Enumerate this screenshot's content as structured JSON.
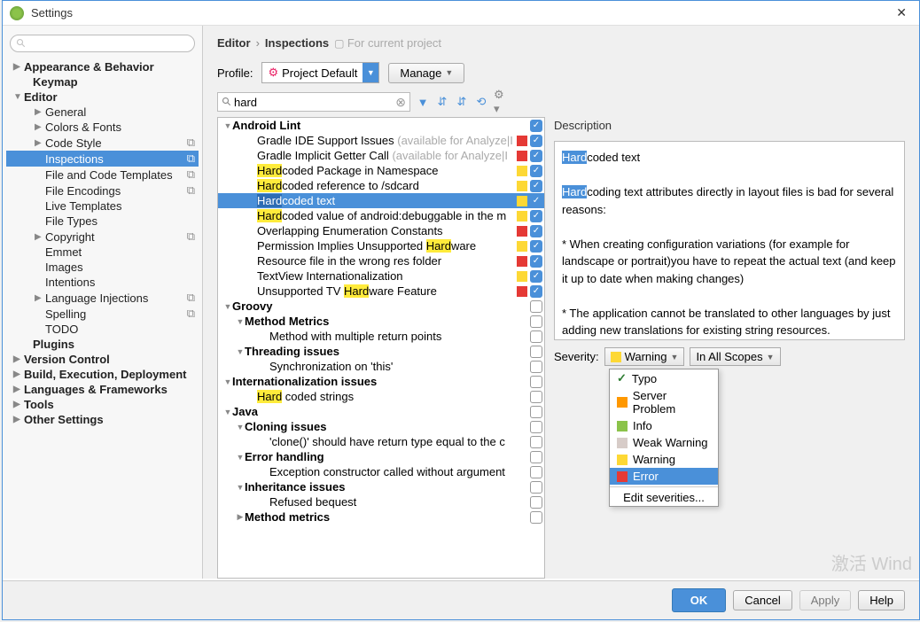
{
  "title": "Settings",
  "breadcrumb": {
    "parent": "Editor",
    "current": "Inspections",
    "scope": "For current project"
  },
  "profile": {
    "label": "Profile:",
    "value": "Project Default",
    "manage": "Manage"
  },
  "sidebar_search": "",
  "filter": {
    "value": "hard"
  },
  "sidebar": [
    {
      "label": "Appearance & Behavior",
      "lvl": 0,
      "bold": true,
      "arrow": "▶"
    },
    {
      "label": "Keymap",
      "lvl": 1,
      "bold": true
    },
    {
      "label": "Editor",
      "lvl": 0,
      "bold": true,
      "arrow": "▼"
    },
    {
      "label": "General",
      "lvl": 2,
      "arrow": "▶"
    },
    {
      "label": "Colors & Fonts",
      "lvl": 2,
      "arrow": "▶"
    },
    {
      "label": "Code Style",
      "lvl": 2,
      "arrow": "▶",
      "copy": true
    },
    {
      "label": "Inspections",
      "lvl": 2,
      "selected": true,
      "copy": true
    },
    {
      "label": "File and Code Templates",
      "lvl": 2,
      "copy": true
    },
    {
      "label": "File Encodings",
      "lvl": 2,
      "copy": true
    },
    {
      "label": "Live Templates",
      "lvl": 2
    },
    {
      "label": "File Types",
      "lvl": 2
    },
    {
      "label": "Copyright",
      "lvl": 2,
      "arrow": "▶",
      "copy": true
    },
    {
      "label": "Emmet",
      "lvl": 2
    },
    {
      "label": "Images",
      "lvl": 2
    },
    {
      "label": "Intentions",
      "lvl": 2
    },
    {
      "label": "Language Injections",
      "lvl": 2,
      "arrow": "▶",
      "copy": true
    },
    {
      "label": "Spelling",
      "lvl": 2,
      "copy": true
    },
    {
      "label": "TODO",
      "lvl": 2
    },
    {
      "label": "Plugins",
      "lvl": 1,
      "bold": true
    },
    {
      "label": "Version Control",
      "lvl": 0,
      "bold": true,
      "arrow": "▶"
    },
    {
      "label": "Build, Execution, Deployment",
      "lvl": 0,
      "bold": true,
      "arrow": "▶"
    },
    {
      "label": "Languages & Frameworks",
      "lvl": 0,
      "bold": true,
      "arrow": "▶"
    },
    {
      "label": "Tools",
      "lvl": 0,
      "bold": true,
      "arrow": "▶"
    },
    {
      "label": "Other Settings",
      "lvl": 0,
      "bold": true,
      "arrow": "▶"
    }
  ],
  "inspections": [
    {
      "indent": 0,
      "arrow": "▼",
      "bold": true,
      "label": "Android Lint",
      "chk": true
    },
    {
      "indent": 2,
      "label": "Gradle IDE Support Issues",
      "gray": " (available for Analyze|I",
      "sev": "error",
      "chk": true
    },
    {
      "indent": 2,
      "label": "Gradle Implicit Getter Call",
      "gray": " (available for Analyze|I",
      "sev": "error",
      "chk": true
    },
    {
      "indent": 2,
      "html": "<span class='hl'>Hard</span>coded Package in Namespace",
      "sev": "warning",
      "chk": true
    },
    {
      "indent": 2,
      "html": "<span class='hl'>Hard</span>coded reference to /sdcard",
      "sev": "warning",
      "chk": true
    },
    {
      "indent": 2,
      "html": "<span class='hl'>Hard</span>coded text",
      "sev": "warning",
      "chk": true,
      "selected": true
    },
    {
      "indent": 2,
      "html": "<span class='hl'>Hard</span>coded value of android:debuggable in the m",
      "sev": "warning",
      "chk": true
    },
    {
      "indent": 2,
      "label": "Overlapping Enumeration Constants",
      "sev": "error",
      "chk": true
    },
    {
      "indent": 2,
      "html": "Permission Implies Unsupported <span class='hl'>Hard</span>ware",
      "sev": "warning",
      "chk": true
    },
    {
      "indent": 2,
      "label": "Resource file in the wrong res folder",
      "sev": "error",
      "chk": true
    },
    {
      "indent": 2,
      "label": "TextView Internationalization",
      "sev": "warning",
      "chk": true
    },
    {
      "indent": 2,
      "html": "Unsupported TV <span class='hl'>Hard</span>ware Feature",
      "sev": "error",
      "chk": true
    },
    {
      "indent": 0,
      "arrow": "▼",
      "bold": true,
      "label": "Groovy",
      "chk": false
    },
    {
      "indent": 1,
      "arrow": "▼",
      "bold": true,
      "label": "Method Metrics",
      "chk": false
    },
    {
      "indent": 3,
      "label": "Method with multiple return points",
      "chk": false
    },
    {
      "indent": 1,
      "arrow": "▼",
      "bold": true,
      "label": "Threading issues",
      "chk": false
    },
    {
      "indent": 3,
      "label": "Synchronization on 'this'",
      "chk": false
    },
    {
      "indent": 0,
      "arrow": "▼",
      "bold": true,
      "label": "Internationalization issues",
      "chk": false
    },
    {
      "indent": 2,
      "html": "<span class='hl'>Hard</span> coded strings",
      "chk": false
    },
    {
      "indent": 0,
      "arrow": "▼",
      "bold": true,
      "label": "Java",
      "chk": false
    },
    {
      "indent": 1,
      "arrow": "▼",
      "bold": true,
      "label": "Cloning issues",
      "chk": false
    },
    {
      "indent": 3,
      "label": "'clone()' should have return type equal to the c",
      "chk": false
    },
    {
      "indent": 1,
      "arrow": "▼",
      "bold": true,
      "label": "Error handling",
      "chk": false
    },
    {
      "indent": 3,
      "label": "Exception constructor called without argument",
      "chk": false
    },
    {
      "indent": 1,
      "arrow": "▼",
      "bold": true,
      "label": "Inheritance issues",
      "chk": false
    },
    {
      "indent": 3,
      "label": "Refused bequest",
      "chk": false
    },
    {
      "indent": 1,
      "arrow": "▶",
      "bold": true,
      "label": "Method metrics",
      "chk": false
    }
  ],
  "description": {
    "heading": "Description",
    "title_hl": "Hard",
    "title_rest": "coded text",
    "p1_hl": "Hard",
    "p1_rest": "coding text attributes directly in layout files is bad for several reasons:",
    "p2": "* When creating configuration variations (for example for landscape or portrait)you have to repeat the actual text (and keep it up to date when making changes)",
    "p3": "* The application cannot be translated to other languages by just adding new translations for existing string resources."
  },
  "severity": {
    "label": "Severity:",
    "value": "Warning",
    "scope": "In All Scopes"
  },
  "severity_menu": {
    "typo": "Typo",
    "server": "Server Problem",
    "info": "Info",
    "weak": "Weak Warning",
    "warning": "Warning",
    "error": "Error",
    "edit": "Edit severities..."
  },
  "footer": {
    "ok": "OK",
    "cancel": "Cancel",
    "apply": "Apply",
    "help": "Help"
  },
  "watermark": "激活 Wind"
}
